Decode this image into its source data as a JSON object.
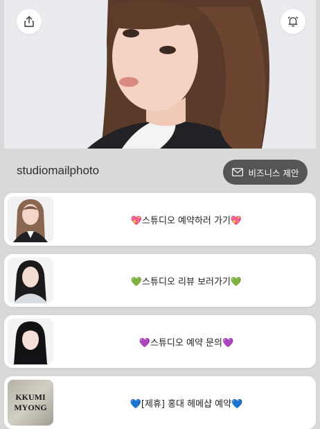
{
  "profile": {
    "username": "studiomailphoto",
    "business_button_label": "비즈니스 제안"
  },
  "icons": {
    "share": "share-icon",
    "bell": "bell-icon",
    "mail": "mail-icon"
  },
  "links": [
    {
      "label": "💖스튜디오 예약하러 가기💖",
      "thumbnail": "portrait-long-hair"
    },
    {
      "label": "💚스튜디오 리뷰 보러가기💚",
      "thumbnail": "portrait-dark-hair"
    },
    {
      "label": "💜스튜디오 예약 문의💜",
      "thumbnail": "portrait-bangs"
    },
    {
      "label": "💙[제휴] 홍대 헤메샵 예약💙",
      "thumbnail": "logo-text",
      "thumbnail_text": [
        "KKUMI",
        "MYONG"
      ]
    }
  ],
  "colors": {
    "page_background": "#d9d9da",
    "card_background": "#ffffff",
    "business_button": "#555555"
  }
}
